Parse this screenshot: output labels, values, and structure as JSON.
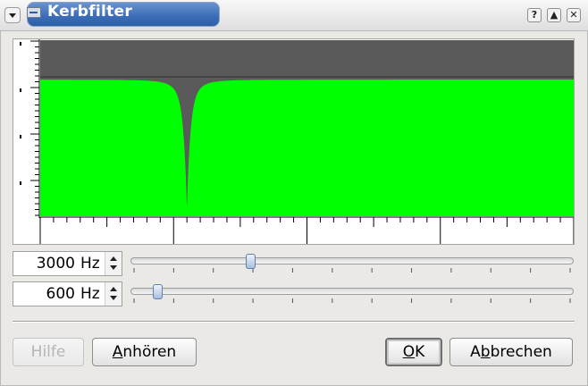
{
  "window": {
    "title": "Kerbfilter",
    "buttons": {
      "help": "?",
      "shade": "▲",
      "close": "✕"
    }
  },
  "graph": {
    "background_color": "#5a5a5a",
    "fill_color": "#00ff00",
    "notch_color": "#4a4a4a"
  },
  "frequency": {
    "value": "3000",
    "unit": "Hz",
    "slider_position": 0.27
  },
  "bandwidth": {
    "value": "600",
    "unit": "Hz",
    "slider_position": 0.06
  },
  "buttons": {
    "help": {
      "label": "Hilfe",
      "enabled": false
    },
    "listen": {
      "label_mnemonic": "A",
      "label_rest": "nhören"
    },
    "ok": {
      "label_mnemonic": "O",
      "label_rest": "K"
    },
    "cancel": {
      "label_pre": "A",
      "label_mnemonic": "b",
      "label_rest": "brechen"
    }
  }
}
